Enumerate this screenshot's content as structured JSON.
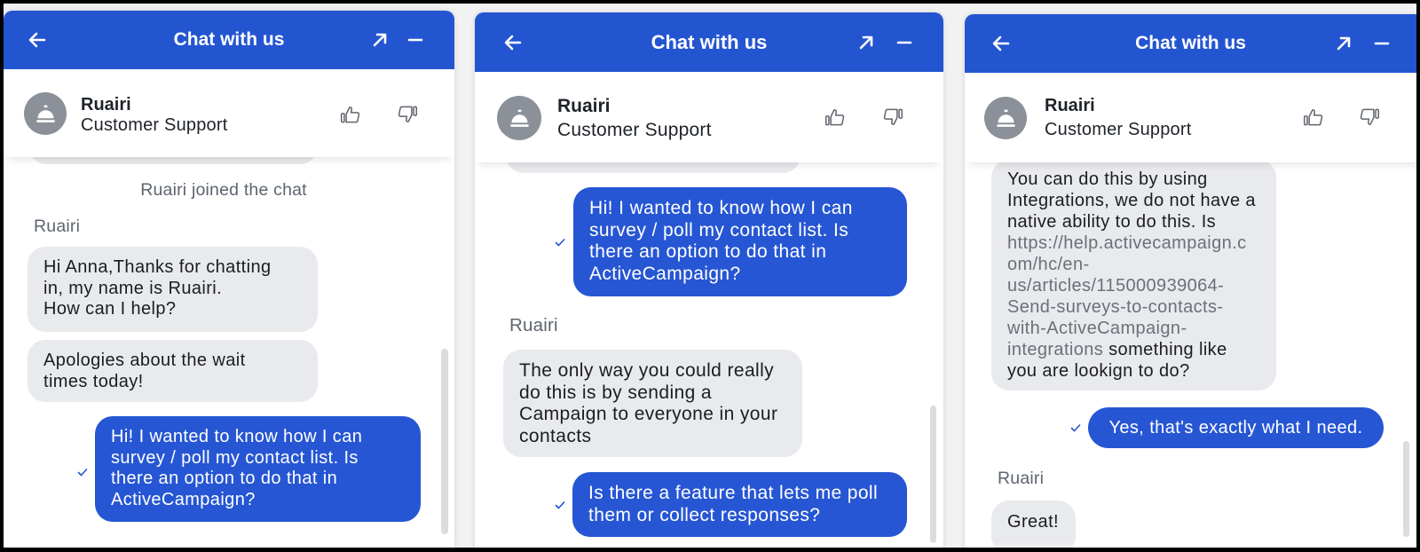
{
  "colors": {
    "brand_blue": "#2455d1",
    "visitor_bubble": "#2656d3",
    "agent_bubble": "#e9eaed",
    "text_primary": "#1b1d21",
    "text_muted": "#5e646e",
    "link": "#6b7079",
    "avatar_bg": "#8b9099"
  },
  "panels": [
    {
      "header": {
        "title": "Chat with us",
        "back_icon": "arrow-left-icon",
        "expand_icon": "arrow-up-right-icon",
        "minimize_icon": "minus-icon"
      },
      "agent": {
        "name": "Ruairi",
        "role": "Customer Support",
        "avatar_icon": "concierge-bell-icon",
        "rate_positive_icon": "thumbs-up-icon",
        "rate_negative_icon": "thumbs-down-icon"
      },
      "messages": [
        {
          "kind": "system",
          "text": "Ruairi joined the chat"
        },
        {
          "kind": "sender_label",
          "text": "Ruairi"
        },
        {
          "kind": "agent",
          "text": "Hi Anna,Thanks for chatting\nin, my name is Ruairi.\nHow can I help?"
        },
        {
          "kind": "agent",
          "text": "Apologies about the wait\ntimes today!"
        },
        {
          "kind": "visitor",
          "text": "Hi! I wanted to know how I can\nsurvey / poll my contact list. Is\nthere an option to do that in\nActiveCampaign?",
          "status_icon": "checkmark-icon"
        }
      ]
    },
    {
      "header": {
        "title": "Chat with us",
        "back_icon": "arrow-left-icon",
        "expand_icon": "arrow-up-right-icon",
        "minimize_icon": "minus-icon"
      },
      "agent": {
        "name": "Ruairi",
        "role": "Customer Support",
        "avatar_icon": "concierge-bell-icon",
        "rate_positive_icon": "thumbs-up-icon",
        "rate_negative_icon": "thumbs-down-icon"
      },
      "messages": [
        {
          "kind": "visitor",
          "text": "Hi! I wanted to know how I can\nsurvey / poll my contact list. Is\nthere an option to do that in\nActiveCampaign?",
          "status_icon": "checkmark-icon"
        },
        {
          "kind": "sender_label",
          "text": "Ruairi"
        },
        {
          "kind": "agent",
          "text": "The only way you could really\ndo this is by sending a\nCampaign to everyone in your\ncontacts"
        },
        {
          "kind": "visitor",
          "text": "Is there a feature that lets me poll\nthem or collect responses?",
          "status_icon": "checkmark-icon"
        }
      ]
    },
    {
      "header": {
        "title": "Chat with us",
        "back_icon": "arrow-left-icon",
        "expand_icon": "arrow-up-right-icon",
        "minimize_icon": "minus-icon"
      },
      "agent": {
        "name": "Ruairi",
        "role": "Customer Support",
        "avatar_icon": "concierge-bell-icon",
        "rate_positive_icon": "thumbs-up-icon",
        "rate_negative_icon": "thumbs-down-icon"
      },
      "messages": [
        {
          "kind": "agent",
          "text_before": "You can do this by using\nIntegrations, we do not have a\nnative ability to do this. Is\n",
          "link_text": "https://help.activecampaign.c\nom/hc/en-\nus/articles/115000939064-\nSend-surveys-to-contacts-\nwith-ActiveCampaign-\nintegrations",
          "text_after": " something like\nyou are lookign to do?"
        },
        {
          "kind": "visitor",
          "text": "Yes, that's exactly what I need.",
          "status_icon": "checkmark-icon"
        },
        {
          "kind": "sender_label",
          "text": "Ruairi"
        },
        {
          "kind": "agent",
          "text": "Great!"
        }
      ]
    }
  ]
}
